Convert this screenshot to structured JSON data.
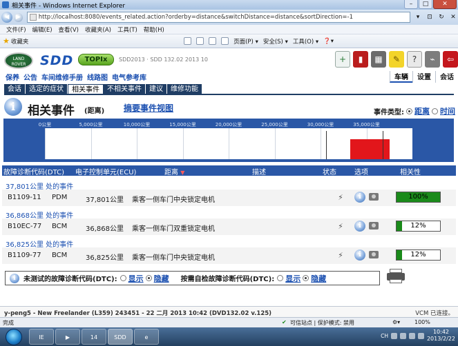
{
  "window": {
    "title": "相关事件 - Windows Internet Explorer",
    "controls": [
      "–",
      "□",
      "✕"
    ]
  },
  "address": {
    "url": "http://localhost:8080/events_related.action?orderby=distance&switchDistance=distance&sortDirection=-1"
  },
  "menu": [
    "文件(F)",
    "编辑(E)",
    "查看(V)",
    "收藏夹(A)",
    "工具(T)",
    "帮助(H)"
  ],
  "favorites": {
    "label": "收藏夹"
  },
  "command_bar": {
    "page": "页面(P) ▾",
    "safety": "安全(S) ▾",
    "tools": "工具(O) ▾",
    "help": "❓▾"
  },
  "sdd": {
    "brand_sdd": "SDD",
    "brand_topix": "TOPIx",
    "brand_landrover": "LAND ROVER",
    "version_text": "SDD2013 · SDD 132.02 2013 10",
    "links": [
      "保养",
      "公告",
      "车间维修手册",
      "线路图",
      "电气参考库"
    ],
    "right_tabs": [
      "车辆",
      "设置",
      "会话"
    ],
    "tabs": [
      "会话",
      "选定的症状",
      "相关事件",
      "不相关事件",
      "建议",
      "维修功能"
    ]
  },
  "page": {
    "title": "相关事件",
    "subtitle": "(距离)",
    "summary_link": "摘要事件视图",
    "event_type_label": "事件类型:",
    "event_type_options": [
      "距离",
      "时间"
    ]
  },
  "scale": {
    "ticks": [
      "0公里",
      "5,000公里",
      "10,000公里",
      "15,000公里",
      "20,000公里",
      "25,000公里",
      "30,000公里",
      "35,000公里"
    ],
    "max_km": 40000,
    "marker_km": 30600,
    "bar_start_km": 33200,
    "bar_end_km": 37500
  },
  "table": {
    "headers": {
      "dtc": "故障诊断代码(DTC)",
      "ecu": "电子控制单元(ECU)",
      "distance": "距离",
      "sort": "▼",
      "description": "描述",
      "status": "状态",
      "options": "选项",
      "relevance": "相关性"
    },
    "groups": [
      {
        "header": "37,801公里 处的事件",
        "dtc": "B1109-11",
        "ecu": "PDM",
        "distance": "37,801公里",
        "description": "乘客一侧车门中央锁定电机",
        "relevance_text": "100%",
        "relevance": 1.0
      },
      {
        "header": "36,868公里 处的事件",
        "dtc": "B10EC-77",
        "ecu": "BCM",
        "distance": "36,868公里",
        "description": "乘客一侧车门双重锁定电机",
        "relevance_text": "12%",
        "relevance": 0.12
      },
      {
        "header": "36,825公里 处的事件",
        "dtc": "B1109-77",
        "ecu": "BCM",
        "distance": "36,825公里",
        "description": "乘客一侧车门中央锁定电机",
        "relevance_text": "12%",
        "relevance": 0.12
      }
    ]
  },
  "options": {
    "untested_label": "未测试的故障诊断代码(DTC):",
    "untested_show": "显示",
    "untested_hide": "隐藏",
    "selfcheck_label": "按需自检故障诊断代码(DTC):",
    "selfcheck_show": "显示",
    "selfcheck_hide": "隐藏"
  },
  "app_status": {
    "vehicle": "y-peng5 - New Freelander (L359) 243451 - 22 二月 2013 10:42 (DVD132.02 v.125)",
    "connection": "VCM 已连接。"
  },
  "ie_status": {
    "left": "完成",
    "trusted": "可信站点 | 保护模式: 禁用",
    "zoom": "100%"
  },
  "taskbar": {
    "items": [
      "IE",
      "▶",
      "14",
      "SDD",
      "e"
    ],
    "lang": "CH",
    "time": "10:42",
    "date": "2013/2/22"
  },
  "colors": {
    "header_blue": "#2a57a6",
    "tab_navy": "#1f3d64",
    "relevance_green": "#1a8a1a",
    "timeline_bar_red": "#e2161b",
    "link_blue": "#1a4fb0"
  }
}
